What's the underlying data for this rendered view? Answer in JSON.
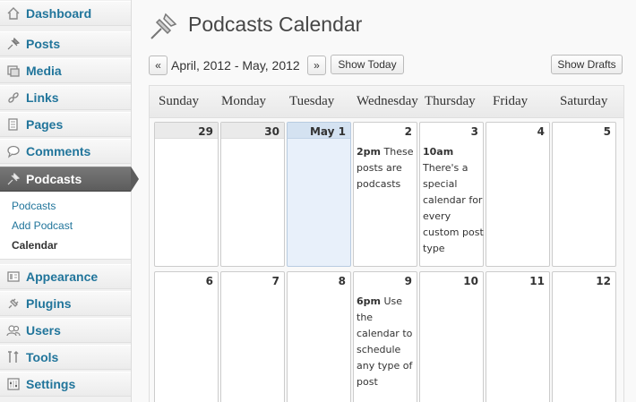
{
  "sidebar": {
    "items": [
      {
        "label": "Dashboard",
        "icon": "dashboard-icon"
      },
      {
        "label": "Posts",
        "icon": "pushpin-icon"
      },
      {
        "label": "Media",
        "icon": "media-icon"
      },
      {
        "label": "Links",
        "icon": "links-icon"
      },
      {
        "label": "Pages",
        "icon": "pages-icon"
      },
      {
        "label": "Comments",
        "icon": "comments-icon"
      },
      {
        "label": "Podcasts",
        "icon": "pushpin-icon"
      },
      {
        "label": "Appearance",
        "icon": "appearance-icon"
      },
      {
        "label": "Plugins",
        "icon": "plugins-icon"
      },
      {
        "label": "Users",
        "icon": "users-icon"
      },
      {
        "label": "Tools",
        "icon": "tools-icon"
      },
      {
        "label": "Settings",
        "icon": "settings-icon"
      }
    ],
    "submenu": [
      "Podcasts",
      "Add Podcast",
      "Calendar"
    ]
  },
  "header": {
    "title": "Podcasts Calendar"
  },
  "toolbar": {
    "prev_label": "«",
    "next_label": "»",
    "range": "April, 2012 - May, 2012",
    "show_today": "Show Today",
    "show_drafts": "Show Drafts"
  },
  "calendar": {
    "days": [
      "Sunday",
      "Monday",
      "Tuesday",
      "Wednesday",
      "Thursday",
      "Friday",
      "Saturday"
    ],
    "week1": [
      "29",
      "30",
      "May 1",
      "2",
      "3",
      "4",
      "5"
    ],
    "week2": [
      "6",
      "7",
      "8",
      "9",
      "10",
      "11",
      "12"
    ],
    "events": {
      "e1_time": "2pm",
      "e1_text": "These posts are podcasts",
      "e2_time": "10am",
      "e2_text": "There's a special calendar for every custom post type",
      "e3_time": "6pm",
      "e3_text": "Use the calendar to schedule any type of post"
    }
  },
  "colors": {
    "link": "#21759b",
    "active_menu": "#5c5c5c",
    "today_cell": "#e8f0fa"
  }
}
